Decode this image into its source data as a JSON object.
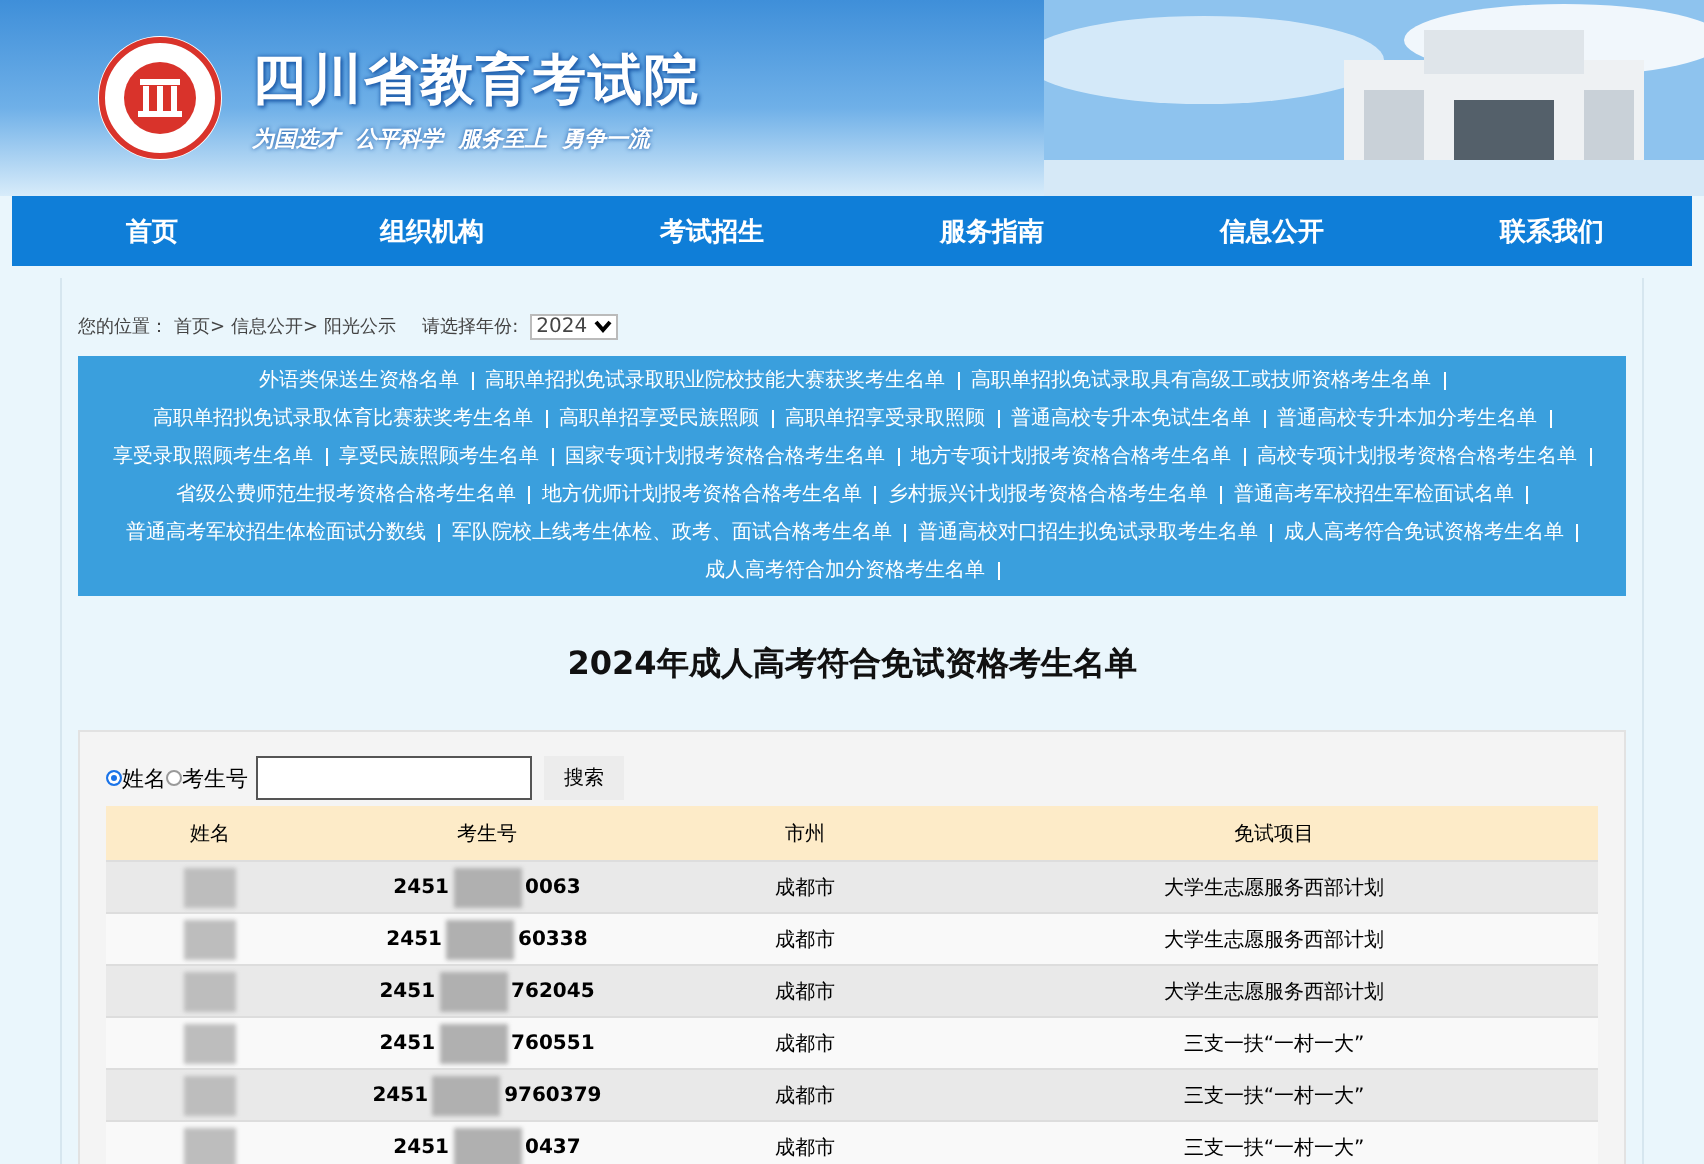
{
  "header": {
    "title": "四川省教育考试院",
    "slogan": "为国选才  公平科学  服务至上  勇争一流"
  },
  "nav": [
    {
      "label": "首页"
    },
    {
      "label": "组织机构"
    },
    {
      "label": "考试招生"
    },
    {
      "label": "服务指南"
    },
    {
      "label": "信息公开"
    },
    {
      "label": "联系我们"
    }
  ],
  "breadcrumb": {
    "label": "您的位置：",
    "items": [
      "首页>",
      "信息公开>",
      "阳光公示"
    ]
  },
  "year_select": {
    "label": "请选择年份:",
    "value": "2024"
  },
  "links": [
    "外语类保送生资格名单",
    "高职单招拟免试录取职业院校技能大赛获奖考生名单",
    "高职单招拟免试录取具有高级工或技师资格考生名单",
    "高职单招拟免试录取体育比赛获奖考生名单",
    "高职单招享受民族照顾",
    "高职单招享受录取照顾",
    "普通高校专升本免试生名单",
    "普通高校专升本加分考生名单",
    "享受录取照顾考生名单",
    "享受民族照顾考生名单",
    "国家专项计划报考资格合格考生名单",
    "地方专项计划报考资格合格考生名单",
    "高校专项计划报考资格合格考生名单",
    "省级公费师范生报考资格合格考生名单",
    "地方优师计划报考资格合格考生名单",
    "乡村振兴计划报考资格合格考生名单",
    "普通高考军校招生军检面试名单",
    "普通高考军校招生体检面试分数线",
    "军队院校上线考生体检、政考、面试合格考生名单",
    "普通高校对口招生拟免试录取考生名单",
    "成人高考符合免试资格考生名单",
    "成人高考符合加分资格考生名单"
  ],
  "page_title": "2024年成人高考符合免试资格考生名单",
  "search": {
    "options": [
      {
        "label": "姓名",
        "selected": true
      },
      {
        "label": "考生号",
        "selected": false
      }
    ],
    "button": "搜索"
  },
  "table": {
    "columns": [
      "姓名",
      "考生号",
      "市州",
      "免试项目"
    ],
    "rows": [
      {
        "id_start": "2451",
        "id_end": "0063",
        "city": "成都市",
        "item": "大学生志愿服务西部计划"
      },
      {
        "id_start": "2451",
        "id_end": "60338",
        "city": "成都市",
        "item": "大学生志愿服务西部计划"
      },
      {
        "id_start": "2451",
        "id_end": "762045",
        "city": "成都市",
        "item": "大学生志愿服务西部计划"
      },
      {
        "id_start": "2451",
        "id_end": "760551",
        "city": "成都市",
        "item": "三支一扶“一村一大”"
      },
      {
        "id_start": "2451",
        "id_end": "9760379",
        "city": "成都市",
        "item": "三支一扶“一村一大”"
      },
      {
        "id_start": "2451",
        "id_end": "0437",
        "city": "成都市",
        "item": "三支一扶“一村一大”"
      }
    ]
  }
}
